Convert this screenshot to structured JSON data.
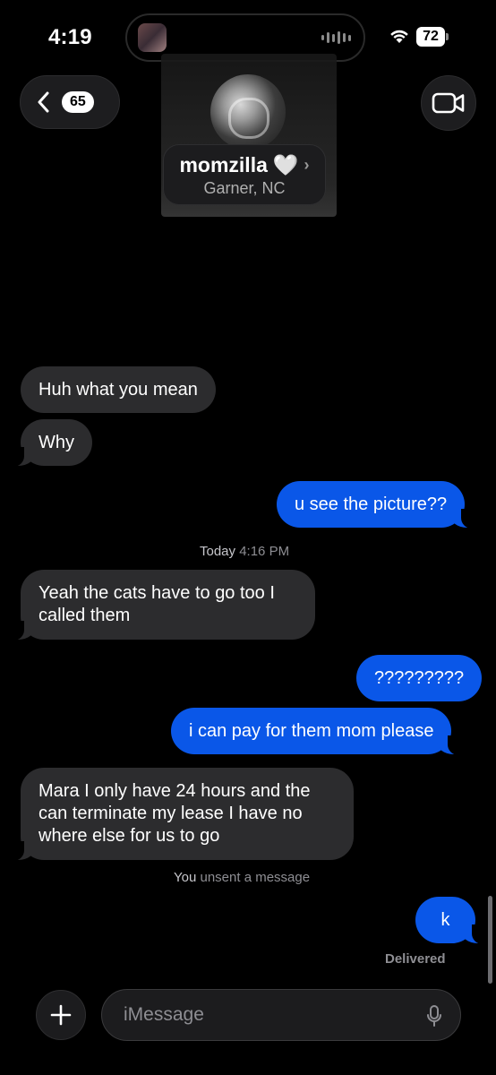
{
  "status_bar": {
    "time": "4:19",
    "battery": "72"
  },
  "header": {
    "back_count": "65",
    "contact_name": "momzilla",
    "contact_heart": "🤍",
    "name_chevron": "›",
    "location": "Garner, NC"
  },
  "messages": [
    {
      "dir": "in",
      "text": "Huh what you mean"
    },
    {
      "dir": "in",
      "text": "Why"
    },
    {
      "dir": "out",
      "text": "u see the picture??"
    },
    {
      "dir": "in",
      "text": "Yeah the cats have to go too I called them"
    },
    {
      "dir": "out",
      "text": "?????????"
    },
    {
      "dir": "out",
      "text": "i can pay for them mom please"
    },
    {
      "dir": "in",
      "text": "Mara I only have 24 hours and the can terminate my lease I have no where else for us to go"
    },
    {
      "dir": "out",
      "text": "k"
    }
  ],
  "timestamp": {
    "day": "Today",
    "time": "4:16 PM"
  },
  "unsent_notice": {
    "actor": "You",
    "text": "unsent a message"
  },
  "delivered": "Delivered",
  "composer": {
    "placeholder": "iMessage"
  },
  "colors": {
    "outgoing": "#0a57e8",
    "incoming": "#2c2c2e",
    "background": "#000000"
  }
}
